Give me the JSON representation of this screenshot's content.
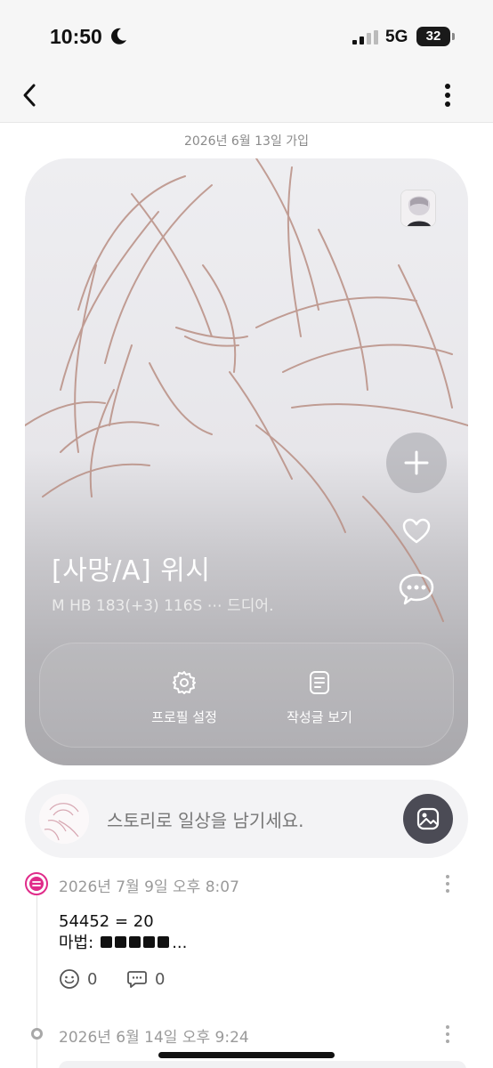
{
  "status_bar": {
    "time": "10:50",
    "network": "5G",
    "battery": "32",
    "icons": [
      "moon-icon",
      "signal-icon",
      "battery-icon"
    ]
  },
  "nav": {
    "back_icon": "chevron-left-icon",
    "more_icon": "more-vertical-icon"
  },
  "joined_date": "2026년 6월 13일 가입",
  "profile": {
    "name": "[사망/A] 위시",
    "bio": "M HB 183(+3) 116S ⋯ 드디어.",
    "actions": [
      {
        "label": "프로필 설정",
        "icon": "gear-icon"
      },
      {
        "label": "작성글 보기",
        "icon": "document-icon"
      }
    ],
    "side_buttons": [
      "plus-icon",
      "heart-icon",
      "chat-bubble-icon"
    ]
  },
  "story": {
    "placeholder": "스토리로 일상을 남기세요.",
    "button_icon": "image-icon"
  },
  "posts": [
    {
      "date": "2026년 7월 9일 오후 8:07",
      "line1": "54452 = 20",
      "line2_prefix": "마법:",
      "line2_suffix": "...",
      "emoji_count": "0",
      "comment_count": "0"
    },
    {
      "date": "2026년 6월 14일 오후 9:24"
    }
  ],
  "colors": {
    "accent_pink": "#e02b8a",
    "story_button": "#4b4b55"
  }
}
